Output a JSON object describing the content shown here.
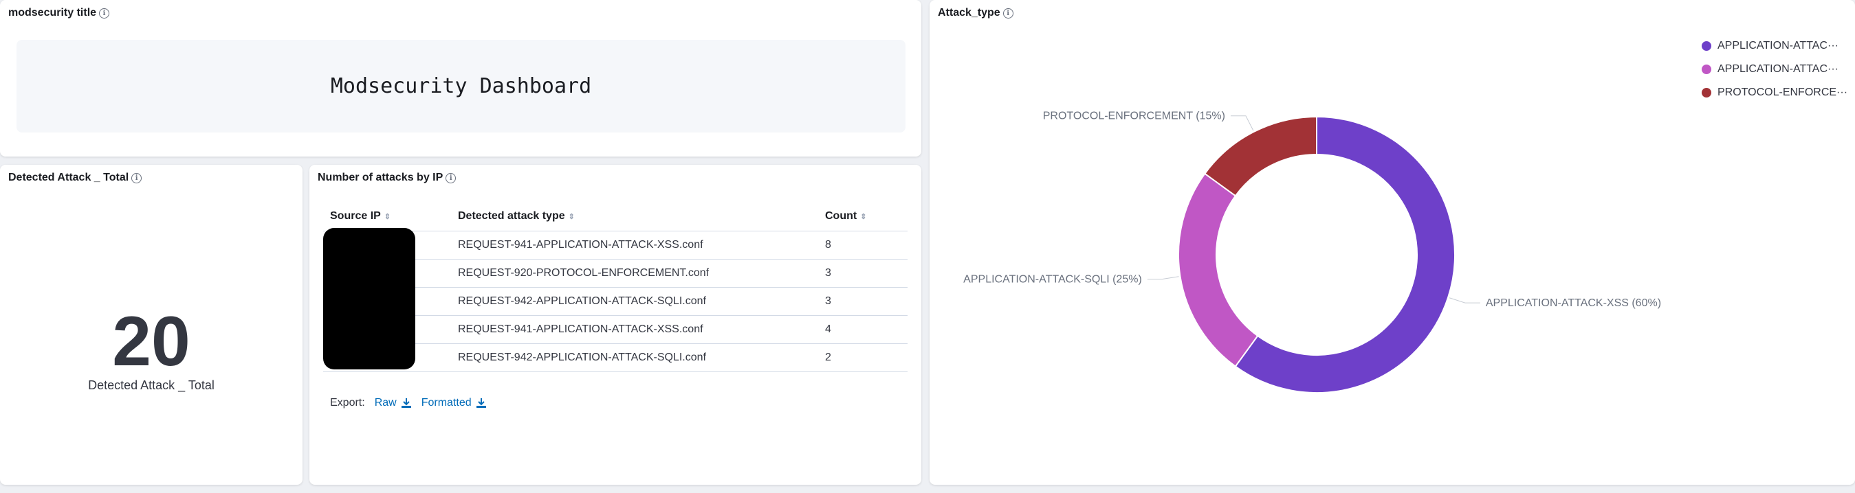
{
  "panels": {
    "title_panel": {
      "title": "modsecurity title",
      "markdown": "Modsecurity Dashboard"
    },
    "metric_panel": {
      "title": "Detected Attack _ Total",
      "value": "20",
      "label": "Detected Attack _ Total"
    },
    "table_panel": {
      "title": "Number of attacks by IP",
      "columns": [
        "Source IP",
        "Detected attack type",
        "Count"
      ],
      "rows": [
        {
          "ip": "",
          "type": "REQUEST-941-APPLICATION-ATTACK-XSS.conf",
          "count": "8"
        },
        {
          "ip": "",
          "type": "REQUEST-920-PROTOCOL-ENFORCEMENT.conf",
          "count": "3"
        },
        {
          "ip": "",
          "type": "REQUEST-942-APPLICATION-ATTACK-SQLI.conf",
          "count": "3"
        },
        {
          "ip": "",
          "type": "REQUEST-941-APPLICATION-ATTACK-XSS.conf",
          "count": "4"
        },
        {
          "ip": "",
          "type": "REQUEST-942-APPLICATION-ATTACK-SQLI.conf",
          "count": "2"
        }
      ],
      "export_label": "Export:",
      "raw_label": "Raw",
      "formatted_label": "Formatted"
    },
    "chart_panel": {
      "title": "Attack_type"
    }
  },
  "legend": [
    {
      "label": "APPLICATION-ATTAC···",
      "color": "#6e40c9"
    },
    {
      "label": "APPLICATION-ATTAC···",
      "color": "#c057c5"
    },
    {
      "label": "PROTOCOL-ENFORCE···",
      "color": "#a23236"
    }
  ],
  "chart_data": {
    "type": "pie",
    "donut": true,
    "categories": [
      "APPLICATION-ATTACK-XSS",
      "APPLICATION-ATTACK-SQLI",
      "PROTOCOL-ENFORCEMENT"
    ],
    "values": [
      60,
      25,
      15
    ],
    "labels": [
      "APPLICATION-ATTACK-XSS (60%)",
      "APPLICATION-ATTACK-SQLI (25%)",
      "PROTOCOL-ENFORCEMENT (15%)"
    ],
    "colors": [
      "#6e40c9",
      "#c057c5",
      "#a23236"
    ],
    "legend_position": "top-right"
  }
}
